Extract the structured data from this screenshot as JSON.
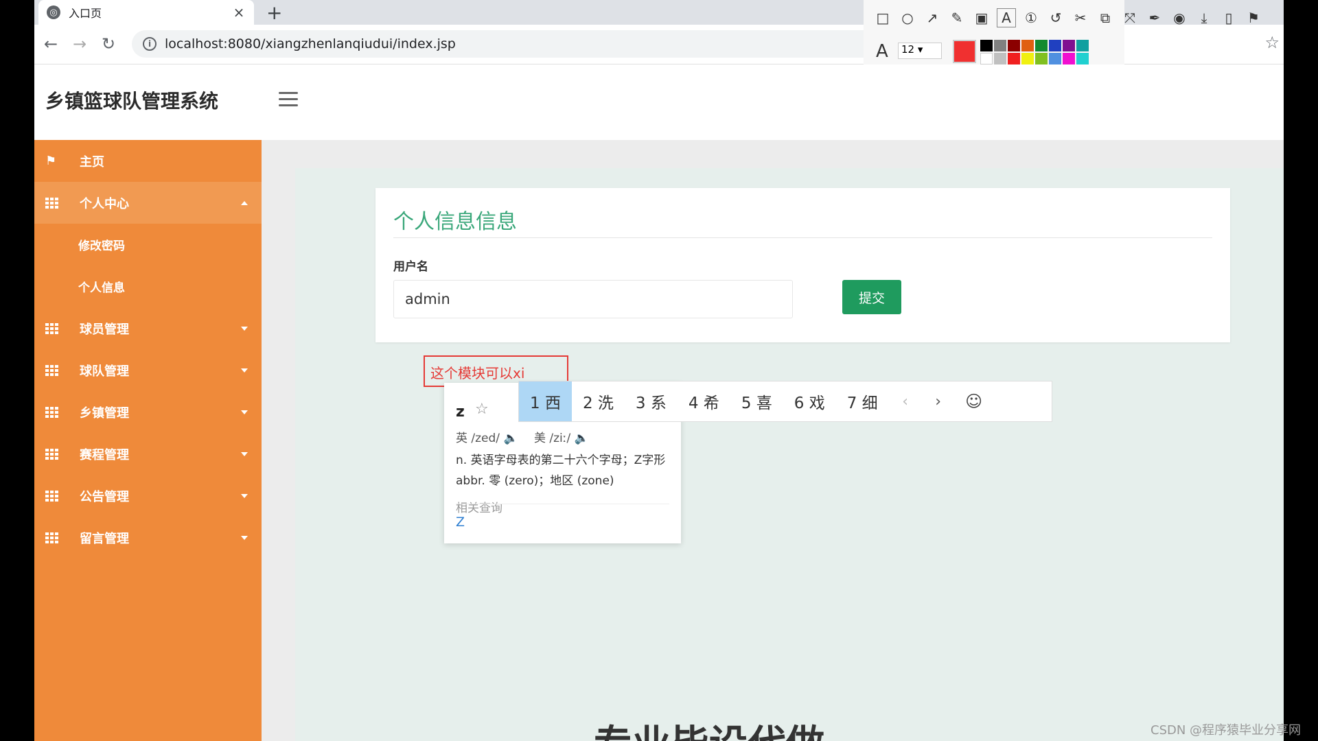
{
  "browser": {
    "tab_title": "入口页",
    "tab_close": "×",
    "new_tab": "+",
    "url": "localhost:8080/xiangzhenlanqiudui/index.jsp",
    "nav": {
      "back": "←",
      "forward": "→",
      "reload": "↻"
    },
    "bookmark": "☆"
  },
  "snap_toolbar": {
    "tools": [
      "□",
      "○",
      "↗",
      "✎",
      "▣",
      "A",
      "①",
      "↺",
      "✂",
      "⧉",
      "⤧",
      "✒",
      "◉",
      "⤓",
      "▯",
      "⚑"
    ],
    "font_icon": "A",
    "font_size": "12",
    "current_color": "#f03030",
    "palette": [
      "#000000",
      "#808080",
      "#8b0000",
      "#e06010",
      "#138a30",
      "#2040c0",
      "#801090",
      "#10a0a0",
      "#ffffff",
      "#c0c0c0",
      "#f02020",
      "#f0f010",
      "#80c020",
      "#5090e0",
      "#f010d0",
      "#20d0d0"
    ]
  },
  "app": {
    "title": "乡镇篮球队管理系统"
  },
  "sidebar": {
    "items": [
      {
        "label": "主页",
        "icon": "flag-icon"
      },
      {
        "label": "个人中心",
        "icon": "grid-icon",
        "open": true
      },
      {
        "label": "修改密码",
        "sub": true
      },
      {
        "label": "个人信息",
        "sub": true
      },
      {
        "label": "球员管理",
        "icon": "grid-icon"
      },
      {
        "label": "球队管理",
        "icon": "grid-icon"
      },
      {
        "label": "乡镇管理",
        "icon": "grid-icon"
      },
      {
        "label": "赛程管理",
        "icon": "grid-icon"
      },
      {
        "label": "公告管理",
        "icon": "grid-icon"
      },
      {
        "label": "留言管理",
        "icon": "grid-icon"
      }
    ]
  },
  "card": {
    "heading": "个人信息信息",
    "username_label": "用户名",
    "username_value": "admin",
    "submit_label": "提交"
  },
  "annotation": {
    "text": "这个模块可以xi"
  },
  "ime": {
    "candidates": [
      "1 西",
      "2 洗",
      "3 系",
      "4 希",
      "5 喜",
      "6 戏",
      "7 细"
    ],
    "prev": "‹",
    "next": "›",
    "emoji": "☺"
  },
  "dictionary": {
    "word": "z",
    "star": "☆",
    "uk_phonetic": "英 /zed/",
    "us_phonetic": "美 /ziː/",
    "speaker": "🔈",
    "def1": "n. 英语字母表的第二十六个字母；Z字形",
    "def2": "abbr. 零 (zero)；地区 (zone)",
    "related_label": "相关查询",
    "related_link": "Z"
  },
  "background_text": "专业毕设代做",
  "watermark": "CSDN @程序猿毕业分享网"
}
